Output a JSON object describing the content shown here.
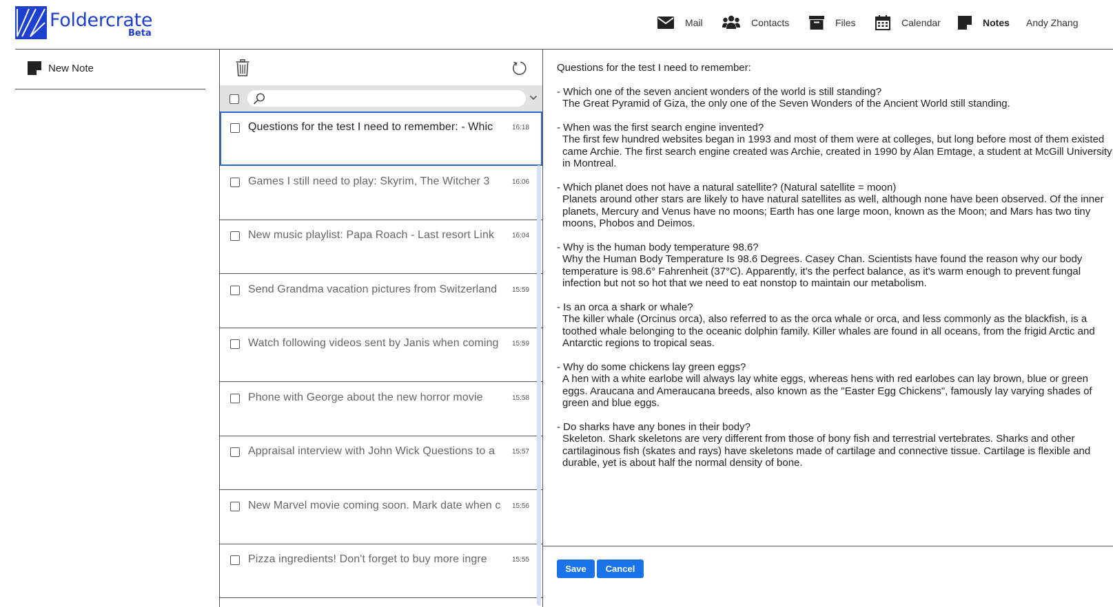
{
  "brand": {
    "name": "Foldercrate",
    "badge": "Beta",
    "accent": "#1d40cf"
  },
  "nav": {
    "items": [
      {
        "label": "Mail",
        "icon": "envelope-icon"
      },
      {
        "label": "Contacts",
        "icon": "contacts-icon"
      },
      {
        "label": "Files",
        "icon": "archive-box-icon"
      },
      {
        "label": "Calendar",
        "icon": "calendar-icon"
      },
      {
        "label": "Notes",
        "icon": "note-icon",
        "active": true
      }
    ],
    "user": "Andy Zhang"
  },
  "sidebar": {
    "new_note_label": "New Note"
  },
  "list": {
    "search_placeholder": "",
    "notes": [
      {
        "title": "Questions for the test I need to remember: - Whic",
        "time": "16:18",
        "selected": true
      },
      {
        "title": "Games I still need to play: Skyrim, The Witcher 3",
        "time": "16:06"
      },
      {
        "title": "New music playlist: Papa Roach - Last resort Link",
        "time": "16:04"
      },
      {
        "title": "Send Grandma vacation pictures from Switzerland",
        "time": "15:59"
      },
      {
        "title": "Watch following videos sent by Janis when coming",
        "time": "15:59"
      },
      {
        "title": "Phone with George about the new horror movie",
        "time": "15:58"
      },
      {
        "title": "Appraisal interview with John Wick Questions to a",
        "time": "15:57"
      },
      {
        "title": "New Marvel movie coming soon. Mark date when c",
        "time": "15:56"
      },
      {
        "title": "Pizza ingredients! Don't forget to buy more ingre",
        "time": "15:55"
      }
    ]
  },
  "editor": {
    "intro": "Questions for the test I need to remember:",
    "qa": [
      {
        "q": "- Which one of the seven ancient wonders of the world is still standing?",
        "a": "The Great Pyramid of Giza, the only one of the Seven Wonders of the Ancient World still standing."
      },
      {
        "q": "- When was the first search engine invented?",
        "a": "The first few hundred websites began in 1993 and most of them were at colleges, but long before most of them existed came Archie. The first search engine created was Archie, created in 1990 by Alan Emtage, a student at McGill University in Montreal."
      },
      {
        "q": "- Which planet does not have a natural satellite? (Natural satellite = moon)",
        "a": "Planets around other stars are likely to have natural satellites as well, although none have been observed. Of the inner planets, Mercury and Venus have no moons; Earth has one large moon, known as the Moon; and Mars has two tiny moons, Phobos and Deimos."
      },
      {
        "q": "- Why is the human body temperature 98.6?",
        "a": "Why the Human Body Temperature Is 98.6 Degrees. Casey Chan. Scientists have found the reason why our body temperature is 98.6° Fahrenheit (37°C). Apparently, it's the perfect balance, as it's warm enough to prevent fungal infection but not so hot that we need to eat nonstop to maintain our metabolism."
      },
      {
        "q": "- Is an orca a shark or whale?",
        "a": "The killer whale (Orcinus orca), also referred to as the orca whale or orca, and less commonly as the blackfish, is a toothed whale belonging to the oceanic dolphin family. Killer whales are found in all oceans, from the frigid Arctic and Antarctic regions to tropical seas."
      },
      {
        "q": "- Why do some chickens lay green eggs?",
        "a": "A hen with a white earlobe will always lay white eggs, whereas hens with red earlobes can lay brown, blue or green eggs. Araucana and Ameraucana breeds, also known as the \"Easter Egg Chickens\", famously lay varying shades of green and blue eggs."
      },
      {
        "q": "- Do sharks have any bones in their body?",
        "a": "Skeleton. Shark skeletons are very different from those of bony fish and terrestrial vertebrates. Sharks and other cartilaginous fish (skates and rays) have skeletons made of cartilage and connective tissue. Cartilage is flexible and durable, yet is about half the normal density of bone."
      }
    ],
    "save_label": "Save",
    "cancel_label": "Cancel",
    "button_color": "#1a73e8"
  }
}
